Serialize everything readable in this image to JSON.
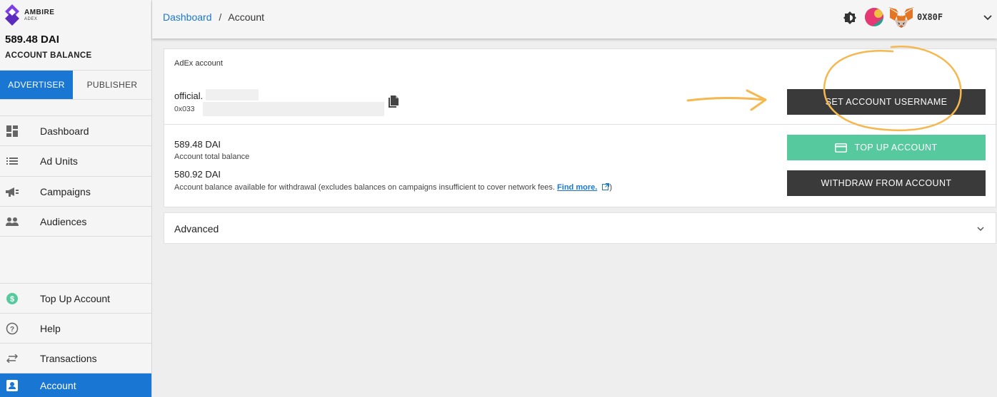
{
  "brand": {
    "name": "AMBIRE",
    "sub": "ADEX"
  },
  "sidebar": {
    "balance": "589.48 DAI",
    "balance_label": "ACCOUNT BALANCE",
    "roles": [
      "ADVERTISER",
      "PUBLISHER"
    ],
    "active_role": "ADVERTISER",
    "items": [
      {
        "label": "Dashboard",
        "icon": "dashboard-icon"
      },
      {
        "label": "Ad Units",
        "icon": "list-icon"
      },
      {
        "label": "Campaigns",
        "icon": "campaign-icon"
      },
      {
        "label": "Audiences",
        "icon": "people-icon"
      }
    ],
    "bottom_items": [
      {
        "label": "Top Up Account",
        "icon": "dollar-icon"
      },
      {
        "label": "Help",
        "icon": "help-icon"
      },
      {
        "label": "Transactions",
        "icon": "swap-icon"
      },
      {
        "label": "Account",
        "icon": "account-icon",
        "active": true
      }
    ]
  },
  "header": {
    "breadcrumb_link": "Dashboard",
    "breadcrumb_sep": "/",
    "breadcrumb_current": "Account",
    "wallet_address": "0X80F"
  },
  "account_card": {
    "title": "AdEx account",
    "username": "official.",
    "address": "0x033",
    "set_username_button": "SET ACCOUNT USERNAME",
    "total_balance": "589.48 DAI",
    "total_balance_label": "Account total balance",
    "available_balance": "580.92 DAI",
    "available_label": "Account balance available for withdrawal (excludes balances on campaigns insufficient to cover network fees.",
    "find_more": "Find more.",
    "closing_paren": ")",
    "top_up_button": "TOP UP ACCOUNT",
    "withdraw_button": "WITHDRAW FROM ACCOUNT"
  },
  "advanced": {
    "label": "Advanced"
  },
  "colors": {
    "primary": "#1976d2",
    "green": "#57c99e",
    "dark_button": "#3a3a3a",
    "annotation": "#f5b74e"
  }
}
